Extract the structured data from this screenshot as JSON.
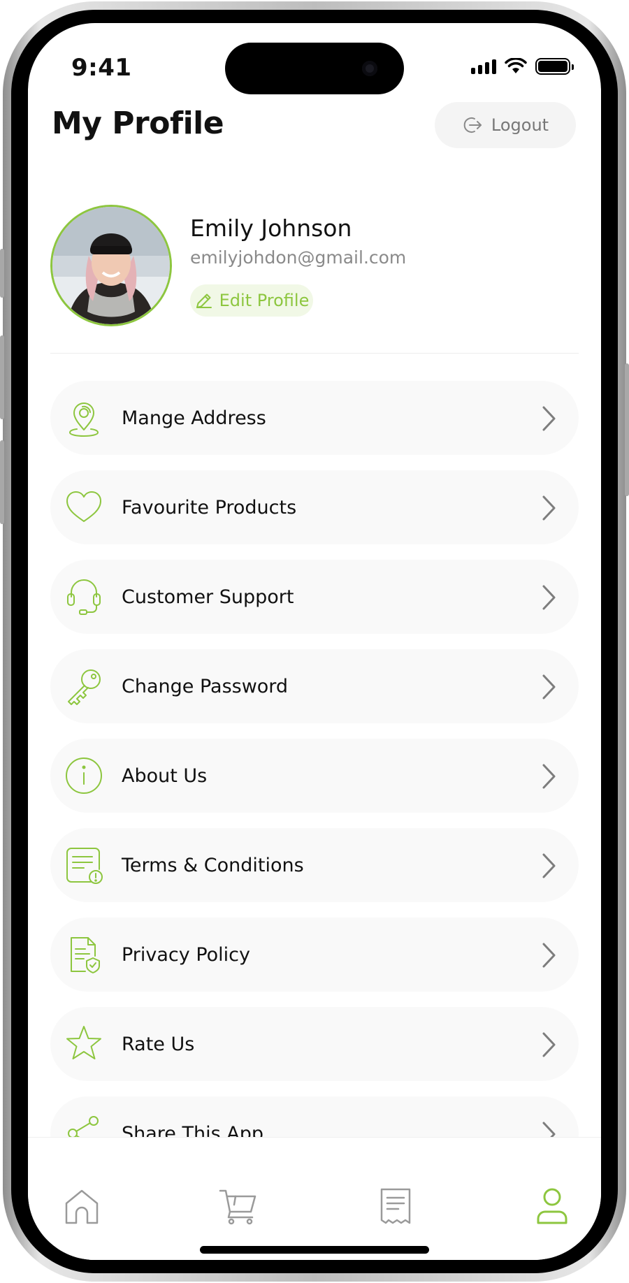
{
  "status_bar": {
    "time": "9:41"
  },
  "header": {
    "title": "My Profile",
    "logout_label": "Logout"
  },
  "profile": {
    "name": "Emily Johnson",
    "email": "emilyjohdon@gmail.com",
    "edit_label": "Edit Profile"
  },
  "menu": {
    "items": [
      {
        "label": "Mange Address",
        "icon": "location-pin-icon"
      },
      {
        "label": "Favourite Products",
        "icon": "heart-icon"
      },
      {
        "label": "Customer Support",
        "icon": "headset-icon"
      },
      {
        "label": "Change Password",
        "icon": "key-icon"
      },
      {
        "label": "About Us",
        "icon": "info-icon"
      },
      {
        "label": "Terms & Conditions",
        "icon": "document-alert-icon"
      },
      {
        "label": "Privacy Policy",
        "icon": "document-shield-icon"
      },
      {
        "label": "Rate Us",
        "icon": "star-icon"
      },
      {
        "label": "Share This App",
        "icon": "share-icon"
      }
    ]
  },
  "bottom_nav": {
    "items": [
      {
        "icon": "home-icon",
        "active": false
      },
      {
        "icon": "cart-icon",
        "active": false
      },
      {
        "icon": "receipt-icon",
        "active": false
      },
      {
        "icon": "user-icon",
        "active": true
      }
    ]
  },
  "colors": {
    "accent": "#8DC63F",
    "text": "#111111",
    "muted": "#8A8A8A",
    "item_bg": "#F9F9F9",
    "icon_gray": "#9A9A9A"
  }
}
